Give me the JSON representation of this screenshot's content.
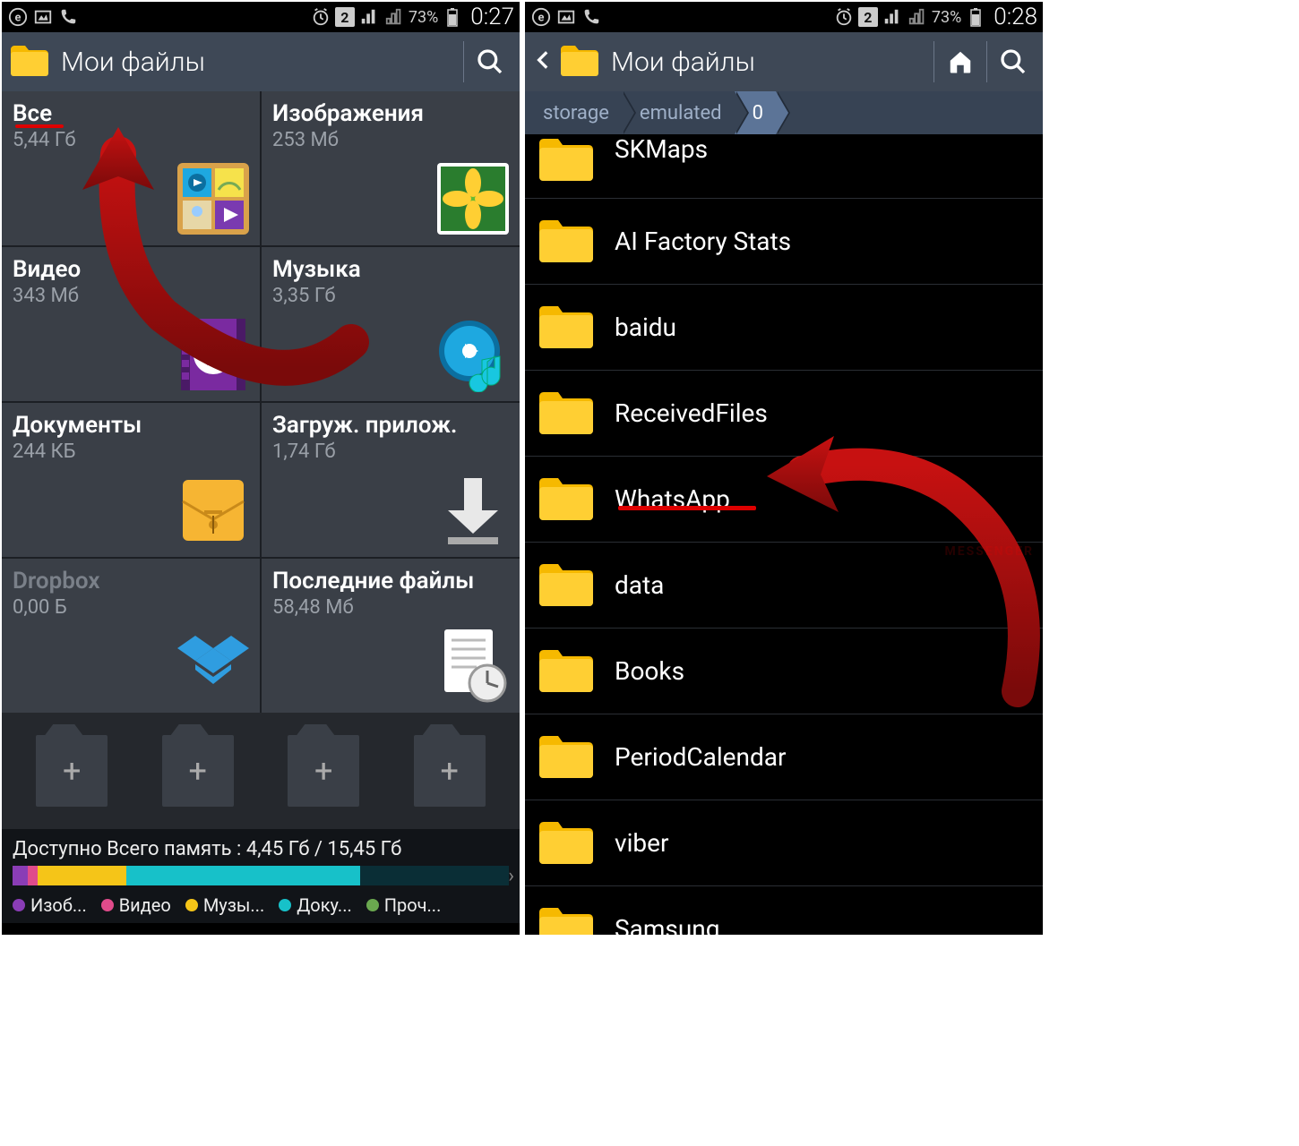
{
  "statusbar": {
    "sim_number": "2",
    "battery_percent": "73%",
    "time_left": "0:27",
    "time_right": "0:28"
  },
  "screen1": {
    "title": "Мои файлы",
    "tiles": [
      {
        "title": "Все",
        "subtitle": "5,44 Гб",
        "icon": "gallery-grid"
      },
      {
        "title": "Изображения",
        "subtitle": "253 Мб",
        "icon": "flower-photo"
      },
      {
        "title": "Видео",
        "subtitle": "343 Мб",
        "icon": "video-play"
      },
      {
        "title": "Музыка",
        "subtitle": "3,35 Гб",
        "icon": "music-disc"
      },
      {
        "title": "Документы",
        "subtitle": "244 КБ",
        "icon": "envelope-doc"
      },
      {
        "title": "Загруж. прилож.",
        "subtitle": "1,74 Гб",
        "icon": "download"
      },
      {
        "title": "Dropbox",
        "subtitle": "0,00 Б",
        "icon": "dropbox",
        "dim": true
      },
      {
        "title": "Последние файлы",
        "subtitle": "58,48 Мб",
        "icon": "recent-doc"
      }
    ],
    "storage": {
      "label": "Доступно Всего память : 4,45 Гб / 15,45 Гб",
      "segments": [
        {
          "color": "#8a3db6",
          "width": "3%"
        },
        {
          "color": "#e04b8b",
          "width": "2%"
        },
        {
          "color": "#f5c518",
          "width": "18%"
        },
        {
          "color": "#17c1c9",
          "width": "47%"
        },
        {
          "color": "#0a2e36",
          "width": "30%"
        }
      ],
      "legend": [
        {
          "color": "#8a3db6",
          "label": "Изоб..."
        },
        {
          "color": "#e04b8b",
          "label": "Видео"
        },
        {
          "color": "#f5c518",
          "label": "Музы..."
        },
        {
          "color": "#17c1c9",
          "label": "Доку..."
        },
        {
          "color": "#6aa84f",
          "label": "Проч..."
        }
      ]
    }
  },
  "screen2": {
    "title": "Мои файлы",
    "breadcrumb": [
      "storage",
      "emulated",
      "0"
    ],
    "folders": [
      "SKMaps",
      "AI Factory Stats",
      "baidu",
      "ReceivedFiles",
      "WhatsApp",
      "data",
      "Books",
      "PeriodCalendar",
      "viber",
      "Samsung"
    ],
    "highlighted_folder": "WhatsApp",
    "watermark": "MESSENGER"
  }
}
